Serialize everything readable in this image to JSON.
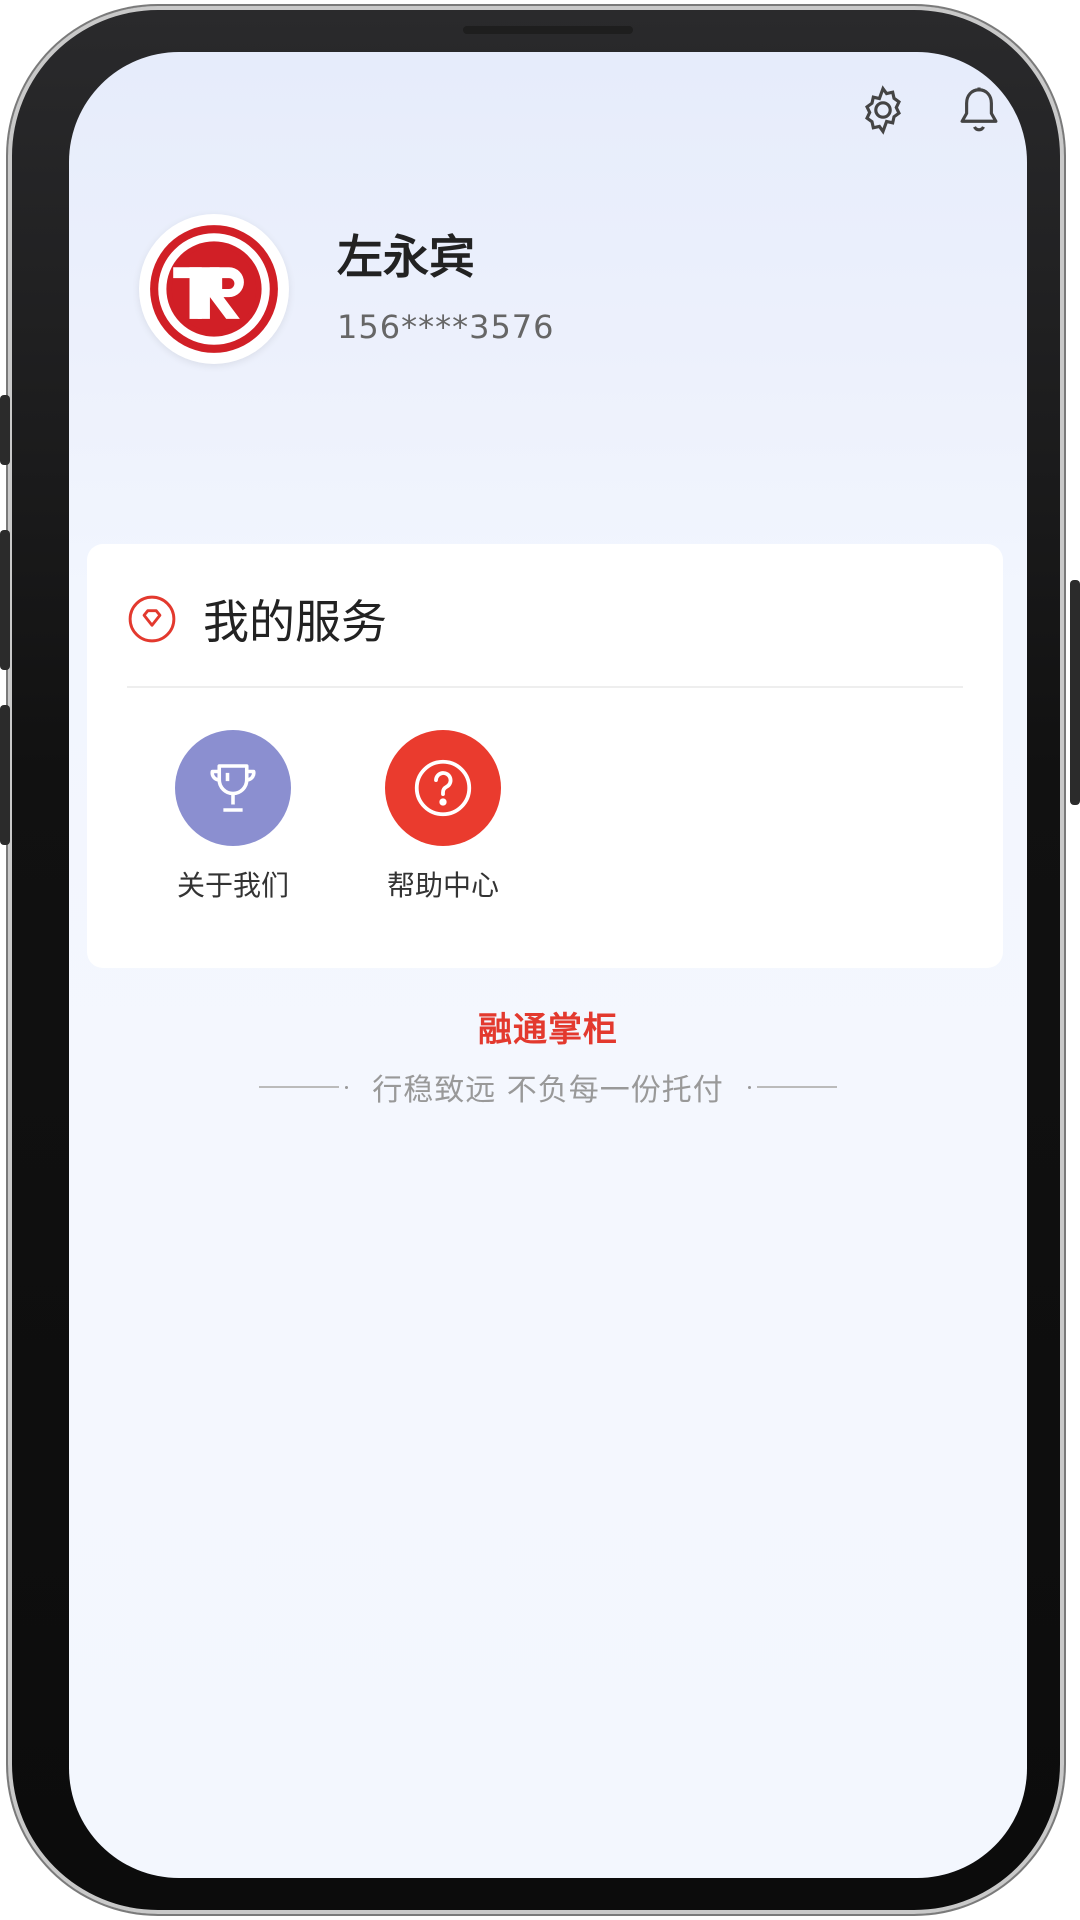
{
  "profile": {
    "name": "左永宾",
    "phone": "156****3576"
  },
  "header": {
    "icons": [
      "gear-icon",
      "bell-icon"
    ]
  },
  "services": {
    "title": "我的服务",
    "items": [
      {
        "label": "关于我们",
        "icon": "trophy-icon",
        "color": "#8b8fd0"
      },
      {
        "label": "帮助中心",
        "icon": "question-icon",
        "color": "#ea3b2e"
      }
    ]
  },
  "footer": {
    "brand": "融通掌柜",
    "slogan": "行稳致远 不负每一份托付"
  },
  "colors": {
    "brand_red": "#d11f26",
    "accent_red": "#e3392e"
  }
}
